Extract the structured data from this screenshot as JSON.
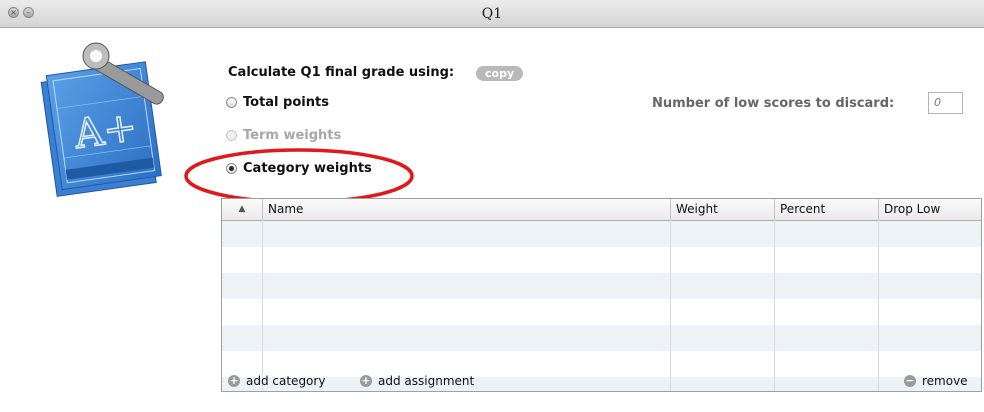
{
  "window": {
    "title": "Q1"
  },
  "calc": {
    "label": "Calculate Q1 final grade using:",
    "copy_label": "copy"
  },
  "options": [
    {
      "label": "Total points",
      "selected": false,
      "disabled": false
    },
    {
      "label": "Term weights",
      "selected": false,
      "disabled": true
    },
    {
      "label": "Category weights",
      "selected": true,
      "disabled": false
    }
  ],
  "low_scores": {
    "label": "Number of low scores to discard:",
    "placeholder": "0"
  },
  "table": {
    "columns": [
      "▲",
      "Name",
      "Weight",
      "Percent",
      "Drop Low"
    ],
    "rows": []
  },
  "actions": {
    "add_category": "add category",
    "add_assignment": "add assignment",
    "remove": "remove"
  },
  "icons": {
    "app": "gradebook-blueprint-icon",
    "add": "plus-circle-icon",
    "remove": "minus-circle-icon"
  },
  "colors": {
    "highlight": "#e0191f",
    "stripe": "#edf2f7",
    "copy_button": "#b9b9b9"
  }
}
